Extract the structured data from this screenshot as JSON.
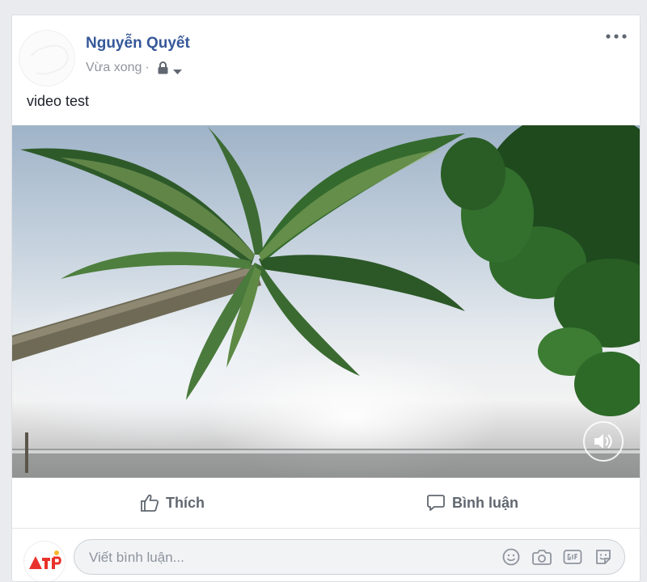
{
  "post": {
    "author": "Nguyễn Quyết",
    "timestamp": "Vừa xong",
    "separator": "·",
    "privacy_icon": "lock-icon",
    "text": "video test"
  },
  "video": {
    "sound_icon": "speaker-icon",
    "muted": false
  },
  "actions": {
    "like_label": "Thích",
    "comment_label": "Bình luận"
  },
  "comment": {
    "placeholder": "Viết bình luận...",
    "tools": [
      "emoji-icon",
      "camera-icon",
      "gif-icon",
      "sticker-icon"
    ]
  },
  "colors": {
    "author": "#365899",
    "action_text": "#606770",
    "page_bg": "#e9ebee"
  }
}
